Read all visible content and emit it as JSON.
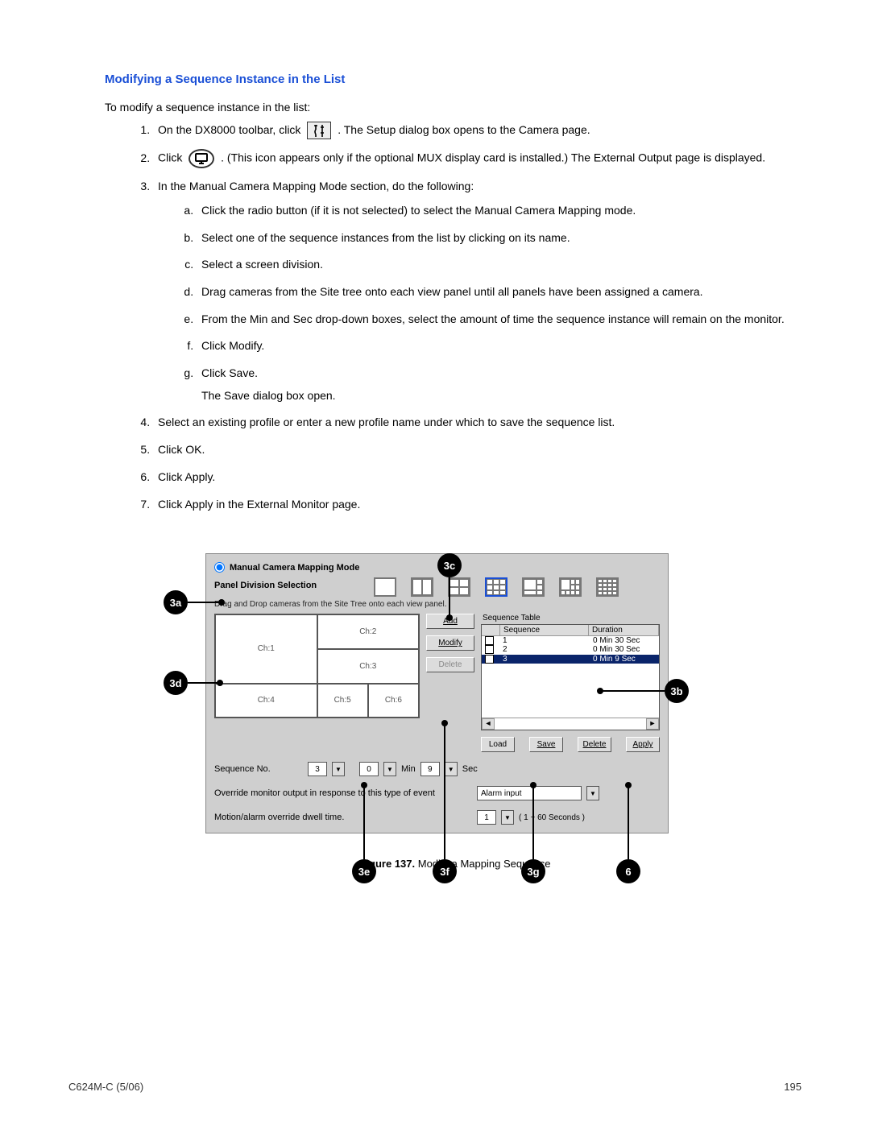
{
  "section_title": "Modifying a Sequence Instance in the List",
  "intro": "To modify a sequence instance in the list:",
  "steps": {
    "s1_a": "On the DX8000 toolbar, click ",
    "s1_b": " . The Setup dialog box opens to the Camera page.",
    "s2_a": "Click ",
    "s2_b": ". (This icon appears only if the optional MUX display card is installed.) The External Output page is displayed.",
    "s3": "In the Manual Camera Mapping Mode section, do the following:",
    "s3a": "Click the radio button (if it is not selected) to select the Manual Camera Mapping mode.",
    "s3b": "Select one of the sequence instances from the list by clicking on its name.",
    "s3c": "Select a screen division.",
    "s3d": "Drag cameras from the Site tree onto each view panel until all panels have been assigned a camera.",
    "s3e": "From the Min and Sec drop-down boxes, select the amount of time the sequence instance will remain on the monitor.",
    "s3f": "Click Modify.",
    "s3g": "Click Save.",
    "s3g_extra": "The Save dialog box open.",
    "s4": "Select an existing profile or enter a new profile name under which to save the sequence list.",
    "s5": "Click OK.",
    "s6": "Click Apply.",
    "s7": "Click Apply in the External Monitor page."
  },
  "callouts": {
    "c3a": "3a",
    "c3b": "3b",
    "c3c": "3c",
    "c3d": "3d",
    "c3e": "3e",
    "c3f": "3f",
    "c3g": "3g",
    "c6": "6"
  },
  "dialog": {
    "mode_label": "Manual Camera Mapping Mode",
    "pds_label": "Panel Division Selection",
    "hint": "Drag and Drop cameras from the Site Tree onto each view panel.",
    "grid": {
      "ch1": "Ch:1",
      "ch2": "Ch:2",
      "ch3": "Ch:3",
      "ch4": "Ch:4",
      "ch5": "Ch:5",
      "ch6": "Ch:6"
    },
    "btns": {
      "add": "Add",
      "modify": "Modify",
      "delete": "Delete",
      "load": "Load",
      "save": "Save",
      "delete2": "Delete",
      "apply": "Apply"
    },
    "seq_title": "Sequence Table",
    "seq_head": {
      "a": "Sequence",
      "b": "Duration"
    },
    "seq_rows": [
      {
        "n": "1",
        "d": "0 Min 30 Sec",
        "sel": false
      },
      {
        "n": "2",
        "d": "0 Min 30 Sec",
        "sel": false
      },
      {
        "n": "3",
        "d": "0 Min 9 Sec",
        "sel": true
      }
    ],
    "seqno_label": "Sequence No.",
    "seqno_val": "3",
    "min_val": "0",
    "min_label": "Min",
    "sec_val": "9",
    "sec_label": "Sec",
    "override_label": "Override monitor output in response to this type of event",
    "alarm_val": "Alarm input",
    "dwell_label": "Motion/alarm override dwell time.",
    "dwell_val": "1",
    "dwell_hint": "( 1 ~ 60 Seconds )"
  },
  "figure": {
    "label": "Figure 137.",
    "caption": "  Modify a Mapping Sequence"
  },
  "footer": {
    "left": "C624M-C (5/06)",
    "right": "195"
  }
}
